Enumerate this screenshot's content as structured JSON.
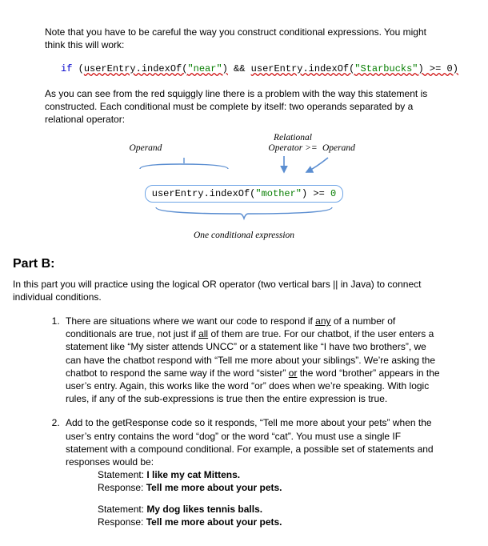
{
  "intro": {
    "p1": "Note that you have to be careful the way you construct conditional expressions.  You might think this will work:"
  },
  "code1": {
    "kw_if": "if",
    "open": " (",
    "part1a": "userEntry.indexOf(",
    "str1": "\"near\"",
    "part1b": ")",
    "op_and": " && ",
    "part2a": "userEntry.indexOf(",
    "str2": "\"Starbucks\"",
    "part2b": ") >= 0",
    "close": ")"
  },
  "intro2": {
    "p1": "As you can see from the red squiggly line there is a problem with the way this statement is constructed.  Each conditional must be complete by itself: two operands separated by a relational operator:"
  },
  "diagram": {
    "relop_l1": "Relational",
    "relop_l2": "Operator >=",
    "operand_left": "Operand",
    "operand_right": "Operand",
    "code_a": "userEntry.indexOf(",
    "code_str": "\"mother\"",
    "code_b": ") >= ",
    "code_num": "0",
    "caption": "One conditional expression"
  },
  "partb": {
    "heading": "Part B:",
    "intro_a": "In this part you will practice using the logical OR operator (two vertical bars  ||  in Java) to connect individual conditions."
  },
  "items": [
    {
      "t1": "There are situations where we want our code to respond if ",
      "u1": "any",
      "t2": " of a number of conditionals are true, not just if ",
      "u2": "all",
      "t3": " of them are true.  For our chatbot, if the user enters a statement like “My sister attends UNCC” or a statement like “I have two brothers”, we can have the chatbot respond with “Tell me more about your siblings”.  We’re asking the chatbot to respond the same way if the word “sister” ",
      "u3": "or",
      "t4": " the word “brother” appears in the user’s entry.  Again, this works like the word “or” does when we’re speaking.  With logic rules, if any of the sub-expressions is true then the entire expression is true."
    },
    {
      "t1": "Add to the getResponse code so it responds, “Tell me more about your pets” when the user’s entry contains the word “dog” or the word “cat”.  You must use a single IF statement with a compound conditional.  For example, a possible set of statements and responses would be:",
      "ex": [
        {
          "stmt_lbl": "Statement: ",
          "stmt": "I like my cat Mittens.",
          "resp_lbl": "Response: ",
          "resp": "Tell me more about your pets."
        },
        {
          "stmt_lbl": "Statement: ",
          "stmt": "My dog likes tennis balls.",
          "resp_lbl": "Response: ",
          "resp": "Tell me more about your pets."
        }
      ]
    }
  ]
}
